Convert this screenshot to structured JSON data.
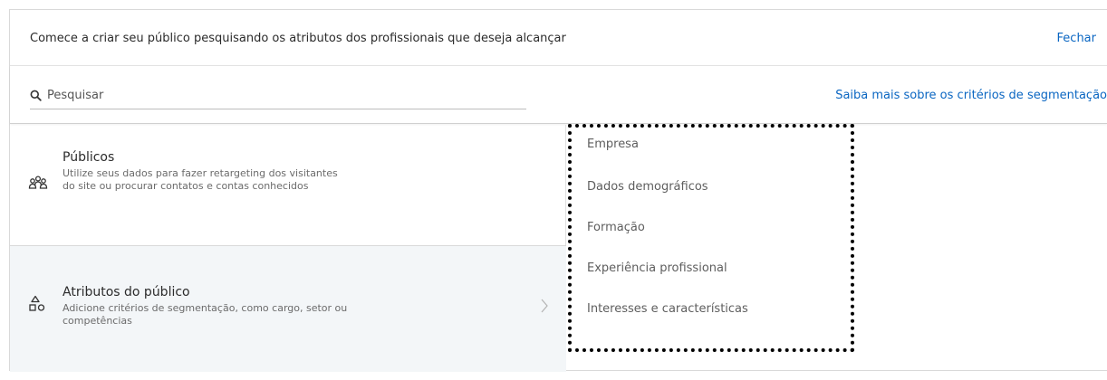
{
  "header": {
    "title": "Comece a criar seu público pesquisando os atributos dos profissionais que deseja alcançar",
    "close_label": "Fechar"
  },
  "search": {
    "placeholder": "Pesquisar",
    "icon": "search-icon",
    "learn_more_label": "Saiba mais sobre os critérios de segmentação"
  },
  "categories": [
    {
      "name": "Públicos",
      "description": "Utilize seus dados para fazer retargeting dos visitantes do site ou procurar contatos e contas conhecidos",
      "icon": "people-group-icon"
    },
    {
      "name": "Atributos do público",
      "description": "Adicione critérios de segmentação, como cargo, setor ou competências",
      "icon": "shapes-icon",
      "selected": true
    }
  ],
  "subcategories": [
    "Empresa",
    "Dados demográficos",
    "Formação",
    "Experiência profissional",
    "Interesses e características"
  ],
  "colors": {
    "link": "#0a66c2",
    "selected_bg": "#f3f6f8",
    "annotation_border": "#000000"
  }
}
